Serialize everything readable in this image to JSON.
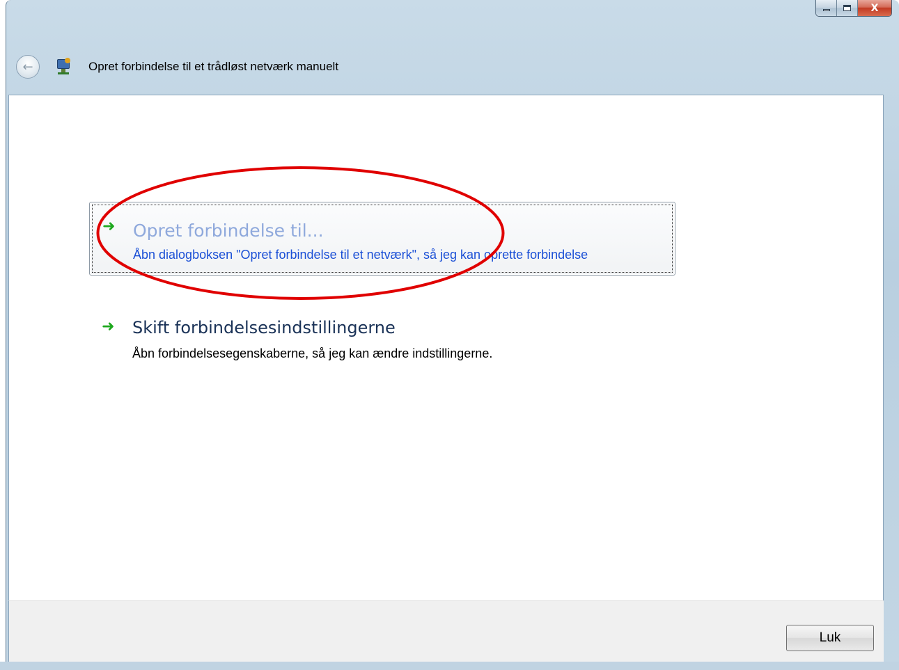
{
  "window": {
    "title": "Opret forbindelse til et trådløst netværk manuelt",
    "caption_buttons": {
      "minimize_icon": "minimize-icon",
      "maximize_icon": "maximize-icon",
      "close_glyph": "X"
    }
  },
  "navigation": {
    "back_glyph": "←",
    "back_icon": "back-arrow-icon",
    "app_icon": "network-connection-icon"
  },
  "options": [
    {
      "title": "Opret forbindelse til...",
      "description": "Åbn dialogboksen \"Opret forbindelse til et netværk\", så jeg kan oprette forbindelse",
      "icon": "green-arrow-icon",
      "state": "focused-hover"
    },
    {
      "title": "Skift forbindelsesindstillingerne",
      "description": "Åbn forbindelsesegenskaberne, så jeg kan ændre indstillingerne.",
      "icon": "green-arrow-icon"
    }
  ],
  "footer": {
    "close_label": "Luk"
  },
  "annotation": {
    "type": "red-ellipse",
    "color": "#e00000"
  },
  "colors": {
    "link_hover": "#8fa9dc",
    "link_desc": "#1a4fd6",
    "arrow": "#1ea81e",
    "annotation": "#e00000"
  }
}
